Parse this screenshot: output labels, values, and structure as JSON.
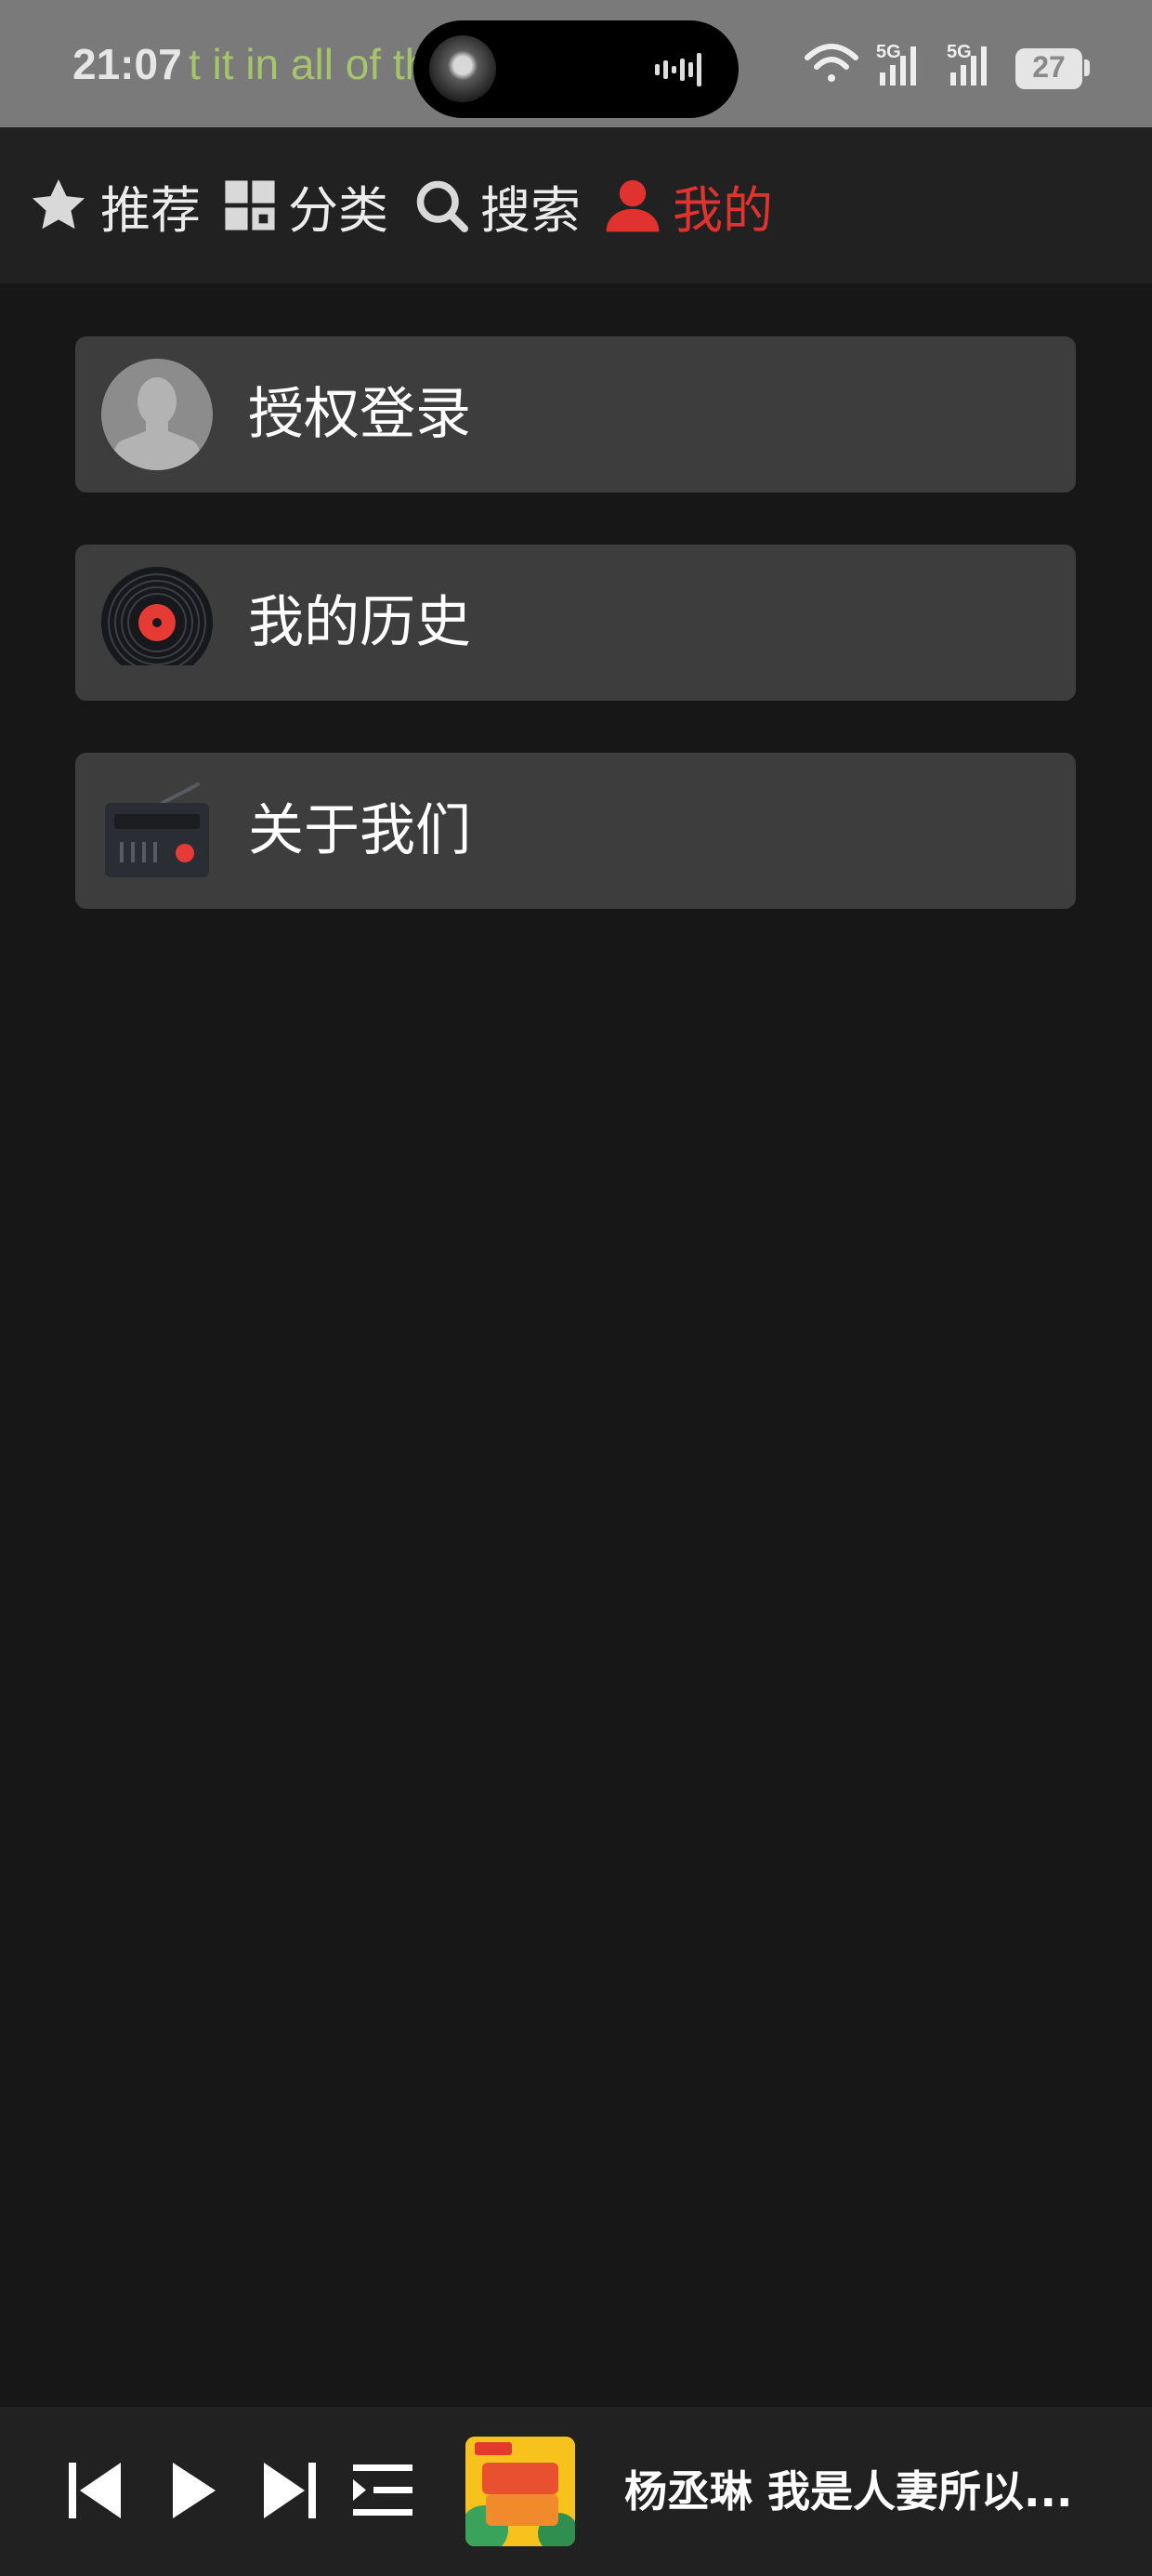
{
  "status_bar": {
    "time": "21:07",
    "marquee": "t it in all of th",
    "network_1": "5G",
    "network_2": "5G",
    "battery": "27"
  },
  "nav": {
    "tabs": [
      {
        "label": "推荐",
        "icon": "star-icon",
        "active": false
      },
      {
        "label": "分类",
        "icon": "grid-icon",
        "active": false
      },
      {
        "label": "搜索",
        "icon": "search-icon",
        "active": false
      },
      {
        "label": "我的",
        "icon": "user-icon",
        "active": true
      }
    ]
  },
  "menu": {
    "items": [
      {
        "label": "授权登录",
        "icon": "avatar-icon"
      },
      {
        "label": "我的历史",
        "icon": "vinyl-record-icon"
      },
      {
        "label": "关于我们",
        "icon": "radio-icon"
      }
    ]
  },
  "player": {
    "now_playing": "杨丞琳 我是人妻所以...",
    "cover_icon": "album-cover-icon",
    "controls": [
      "previous-icon",
      "play-icon",
      "next-icon",
      "playlist-icon"
    ]
  },
  "colors": {
    "accent": "#e0322f",
    "background": "#171717",
    "nav_bg": "#212121",
    "card_bg": "#3d3d3d",
    "status_bar_bg": "#7a7a7a"
  }
}
